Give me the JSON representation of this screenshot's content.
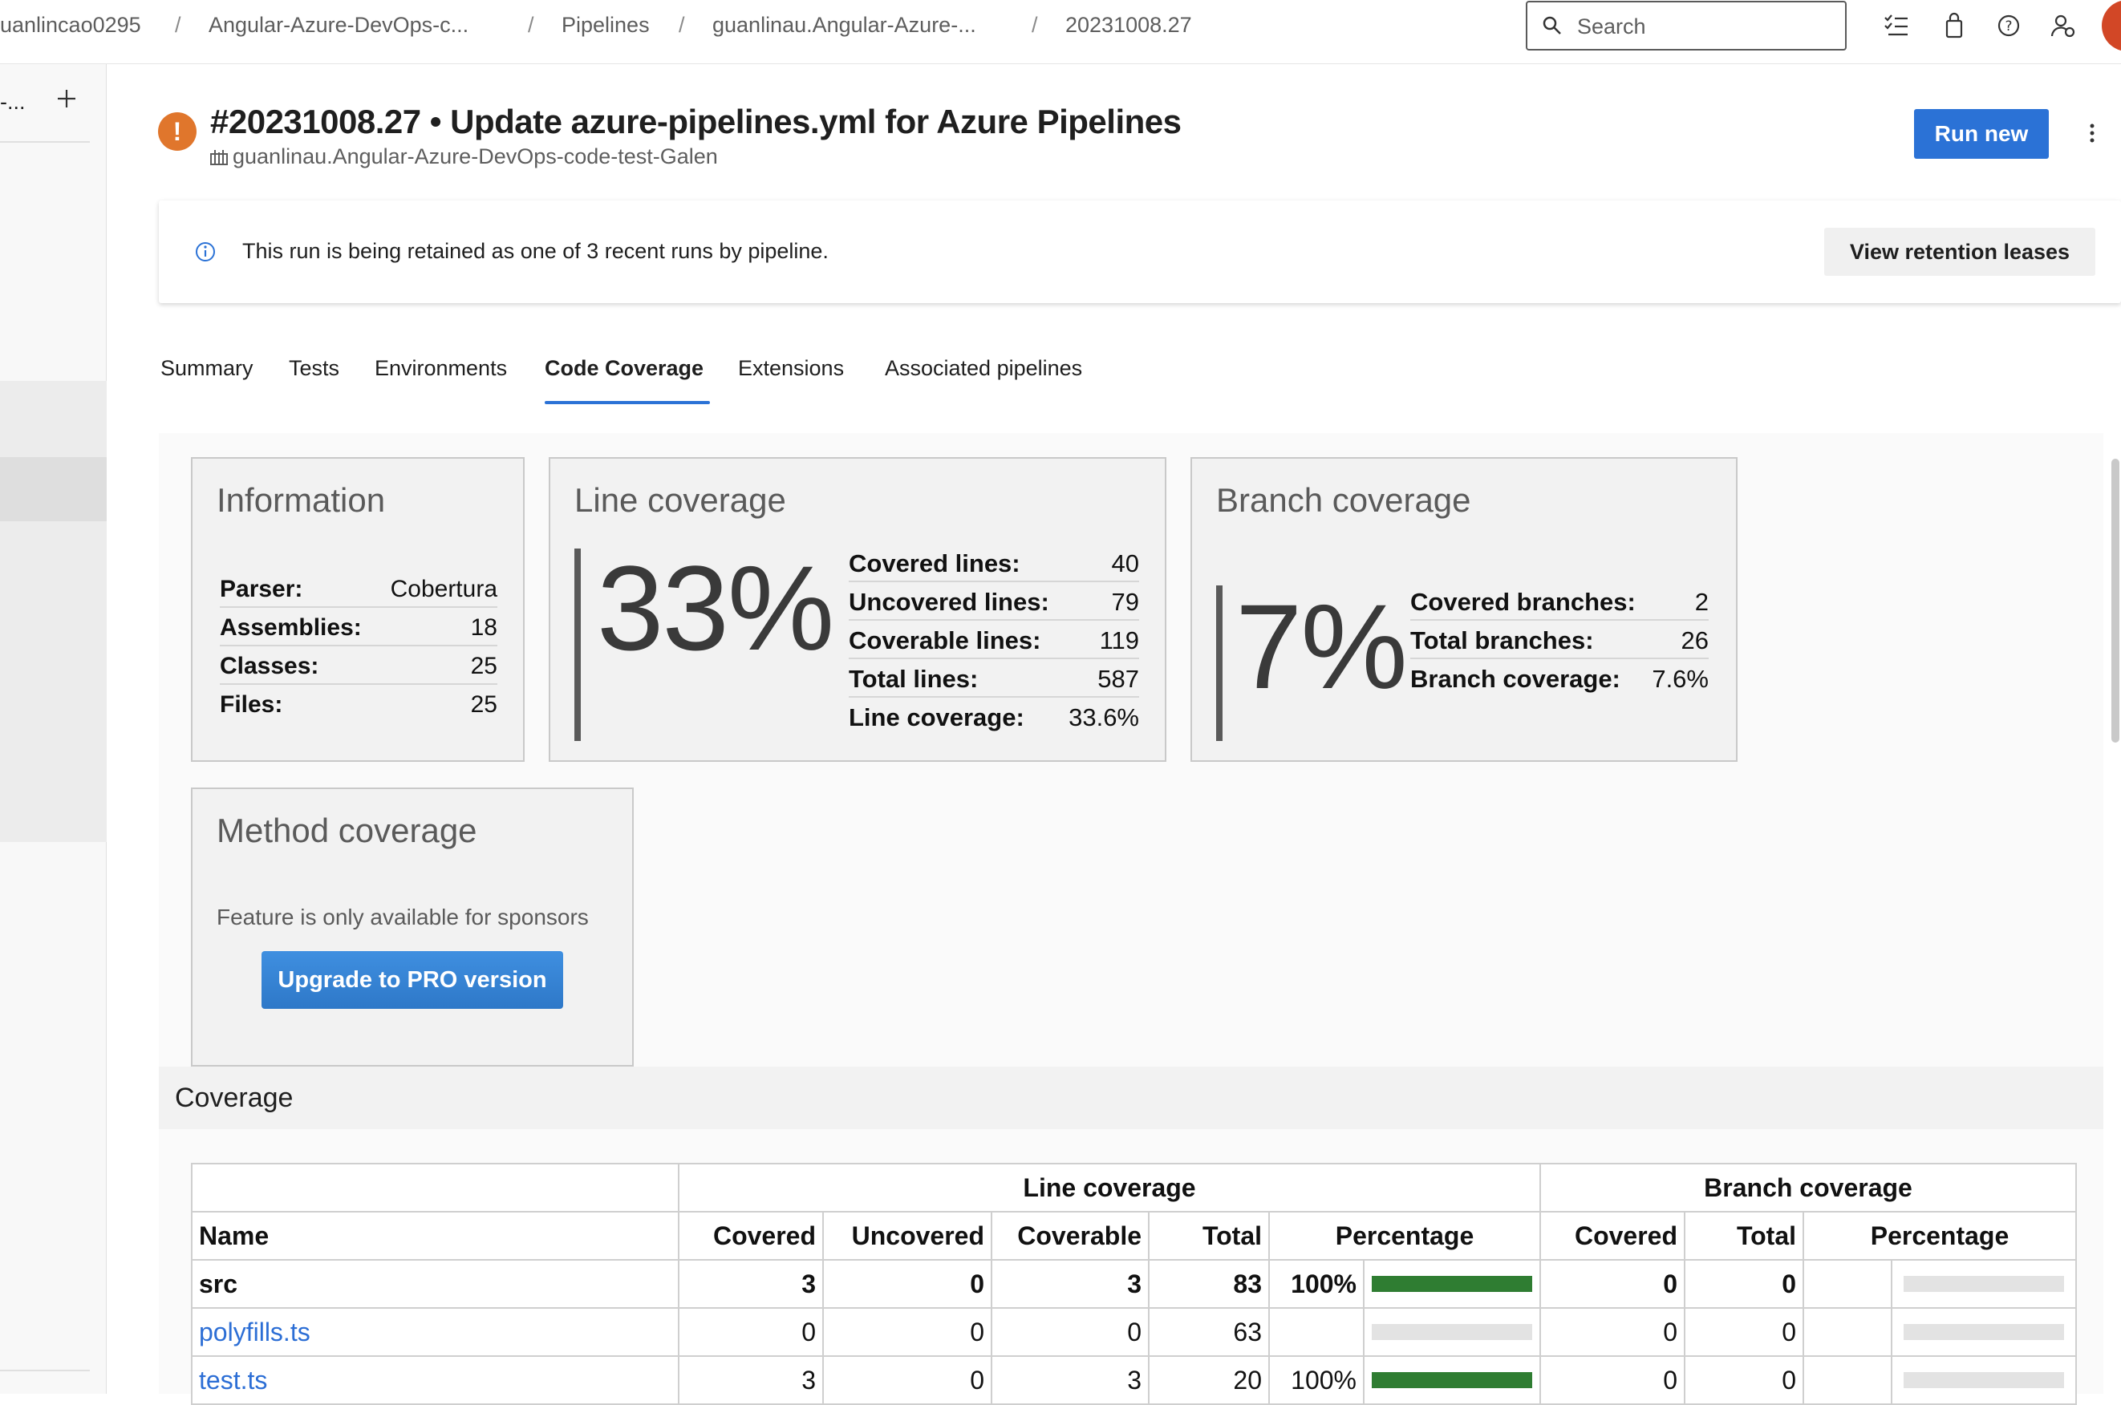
{
  "breadcrumbs": [
    {
      "label": "uanlincao0295"
    },
    {
      "label": "Angular-Azure-DevOps-c..."
    },
    {
      "label": "Pipelines"
    },
    {
      "label": "guanlinau.Angular-Azure-..."
    },
    {
      "label": "20231008.27"
    }
  ],
  "search": {
    "placeholder": "Search"
  },
  "leftrail": {
    "project": "-..."
  },
  "run": {
    "title": "#20231008.27 • Update azure-pipelines.yml for Azure Pipelines",
    "repo": "guanlinau.Angular-Azure-DevOps-code-test-Galen",
    "status_icon": "!",
    "run_new_label": "Run new"
  },
  "banner": {
    "text": "This run is being retained as one of 3 recent runs by pipeline.",
    "button_label": "View retention leases"
  },
  "tabs": [
    {
      "label": "Summary"
    },
    {
      "label": "Tests"
    },
    {
      "label": "Environments"
    },
    {
      "label": "Code Coverage",
      "active": true
    },
    {
      "label": "Extensions"
    },
    {
      "label": "Associated pipelines"
    }
  ],
  "information": {
    "title": "Information",
    "rows": [
      {
        "label": "Parser:",
        "value": "Cobertura"
      },
      {
        "label": "Assemblies:",
        "value": "18"
      },
      {
        "label": "Classes:",
        "value": "25"
      },
      {
        "label": "Files:",
        "value": "25"
      }
    ]
  },
  "line_coverage": {
    "title": "Line coverage",
    "percent": "33%",
    "rows": [
      {
        "label": "Covered lines:",
        "value": "40"
      },
      {
        "label": "Uncovered lines:",
        "value": "79"
      },
      {
        "label": "Coverable lines:",
        "value": "119"
      },
      {
        "label": "Total lines:",
        "value": "587"
      },
      {
        "label": "Line coverage:",
        "value": "33.6%"
      }
    ]
  },
  "branch_coverage": {
    "title": "Branch coverage",
    "percent": "7%",
    "rows": [
      {
        "label": "Covered branches:",
        "value": "2"
      },
      {
        "label": "Total branches:",
        "value": "26"
      },
      {
        "label": "Branch coverage:",
        "value": "7.6%"
      }
    ]
  },
  "method_coverage": {
    "title": "Method coverage",
    "text": "Feature is only available for sponsors",
    "button_label": "Upgrade to PRO version"
  },
  "coverage_section": {
    "label": "Coverage",
    "group_headers": {
      "line": "Line coverage",
      "branch": "Branch coverage"
    },
    "columns": {
      "name": "Name",
      "covered": "Covered",
      "uncovered": "Uncovered",
      "coverable": "Coverable",
      "total": "Total",
      "percentage": "Percentage",
      "b_covered": "Covered",
      "b_total": "Total",
      "b_percentage": "Percentage"
    },
    "rows": [
      {
        "name": "src",
        "is_group": true,
        "covered": "3",
        "uncovered": "0",
        "coverable": "3",
        "total": "83",
        "pct_text": "100%",
        "line_fill": 1.0,
        "b_covered": "0",
        "b_total": "0",
        "b_pct_text": "",
        "branch_fill": 0
      },
      {
        "name": "polyfills.ts",
        "is_group": false,
        "covered": "0",
        "uncovered": "0",
        "coverable": "0",
        "total": "63",
        "pct_text": "",
        "line_fill": 0,
        "b_covered": "0",
        "b_total": "0",
        "b_pct_text": "",
        "branch_fill": 0
      },
      {
        "name": "test.ts",
        "is_group": false,
        "covered": "3",
        "uncovered": "0",
        "coverable": "3",
        "total": "20",
        "pct_text": "100%",
        "line_fill": 1.0,
        "b_covered": "0",
        "b_total": "0",
        "b_pct_text": "",
        "branch_fill": 0
      }
    ]
  },
  "colors": {
    "accent": "#2b72d6",
    "status_warning": "#e0762c",
    "coverage_fill": "#2f7d32",
    "coverage_empty": "#e3e3e3"
  }
}
